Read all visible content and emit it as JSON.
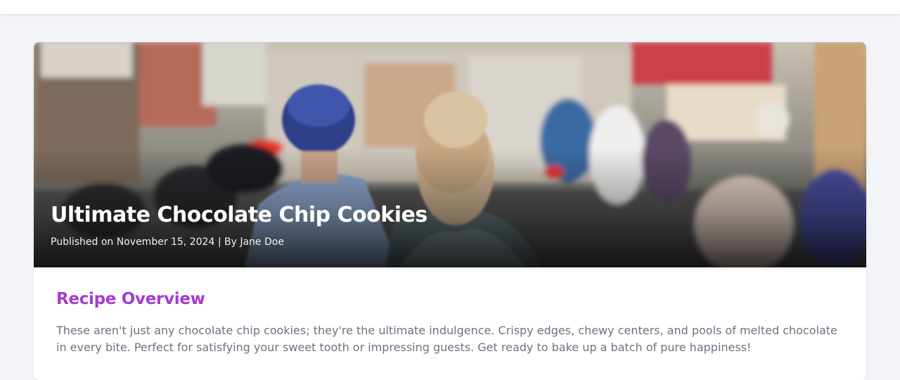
{
  "recipe": {
    "title": "Ultimate Chocolate Chip Cookies",
    "meta": "Published on November 15, 2024 | By Jane Doe",
    "overview_heading": "Recipe Overview",
    "overview_text": "These aren't just any chocolate chip cookies; they're the ultimate indulgence. Crispy edges, chewy centers, and pools of melted chocolate in every bite. Perfect for satisfying your sweet tooth or impressing guests. Get ready to bake up a batch of pure happiness!"
  },
  "colors": {
    "page_background": "#f2f4f7",
    "heading_accent": "#a33bd1",
    "body_text": "#6b7280"
  }
}
